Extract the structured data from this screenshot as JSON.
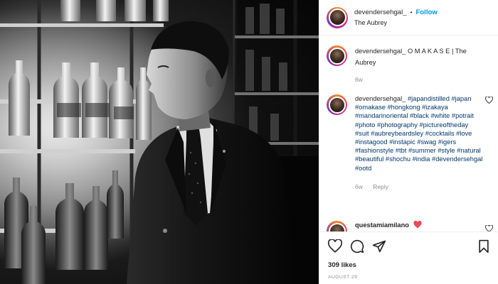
{
  "header": {
    "username": "devendersehgal_",
    "separator": "•",
    "follow_label": "Follow",
    "location": "The Aubrey"
  },
  "caption": {
    "username": "devendersehgal_",
    "text": "O M A K A S E | The Aubrey",
    "time": "6w"
  },
  "comment1": {
    "username": "devendersehgal_",
    "hashtags": "#japandistilled #japan #omakase #hongkong #izakaya #mandarinoriental #black #white #potrait #photo #photography #pictureoftheday #suit #aubreybeardsley #cocktails #love #instagood #instapic #swag #igers #fashionstyle #tbt #summer #style #natural #beautiful #shochu #india #devendersehgal #ootd",
    "time": "6w",
    "reply_label": "Reply"
  },
  "comment2": {
    "username": "questamiamilano"
  },
  "actions": {
    "likes": "309 likes",
    "date": "AUGUST 29"
  },
  "colors": {
    "link_blue": "#0095f6",
    "hashtag_blue": "#00376b",
    "muted_gray": "#8e8e8e",
    "heart_red": "#ed4956",
    "border": "#efefef"
  },
  "icons": [
    "heart-icon",
    "comment-icon",
    "share-icon",
    "bookmark-icon",
    "small-heart-icon",
    "avatar"
  ]
}
